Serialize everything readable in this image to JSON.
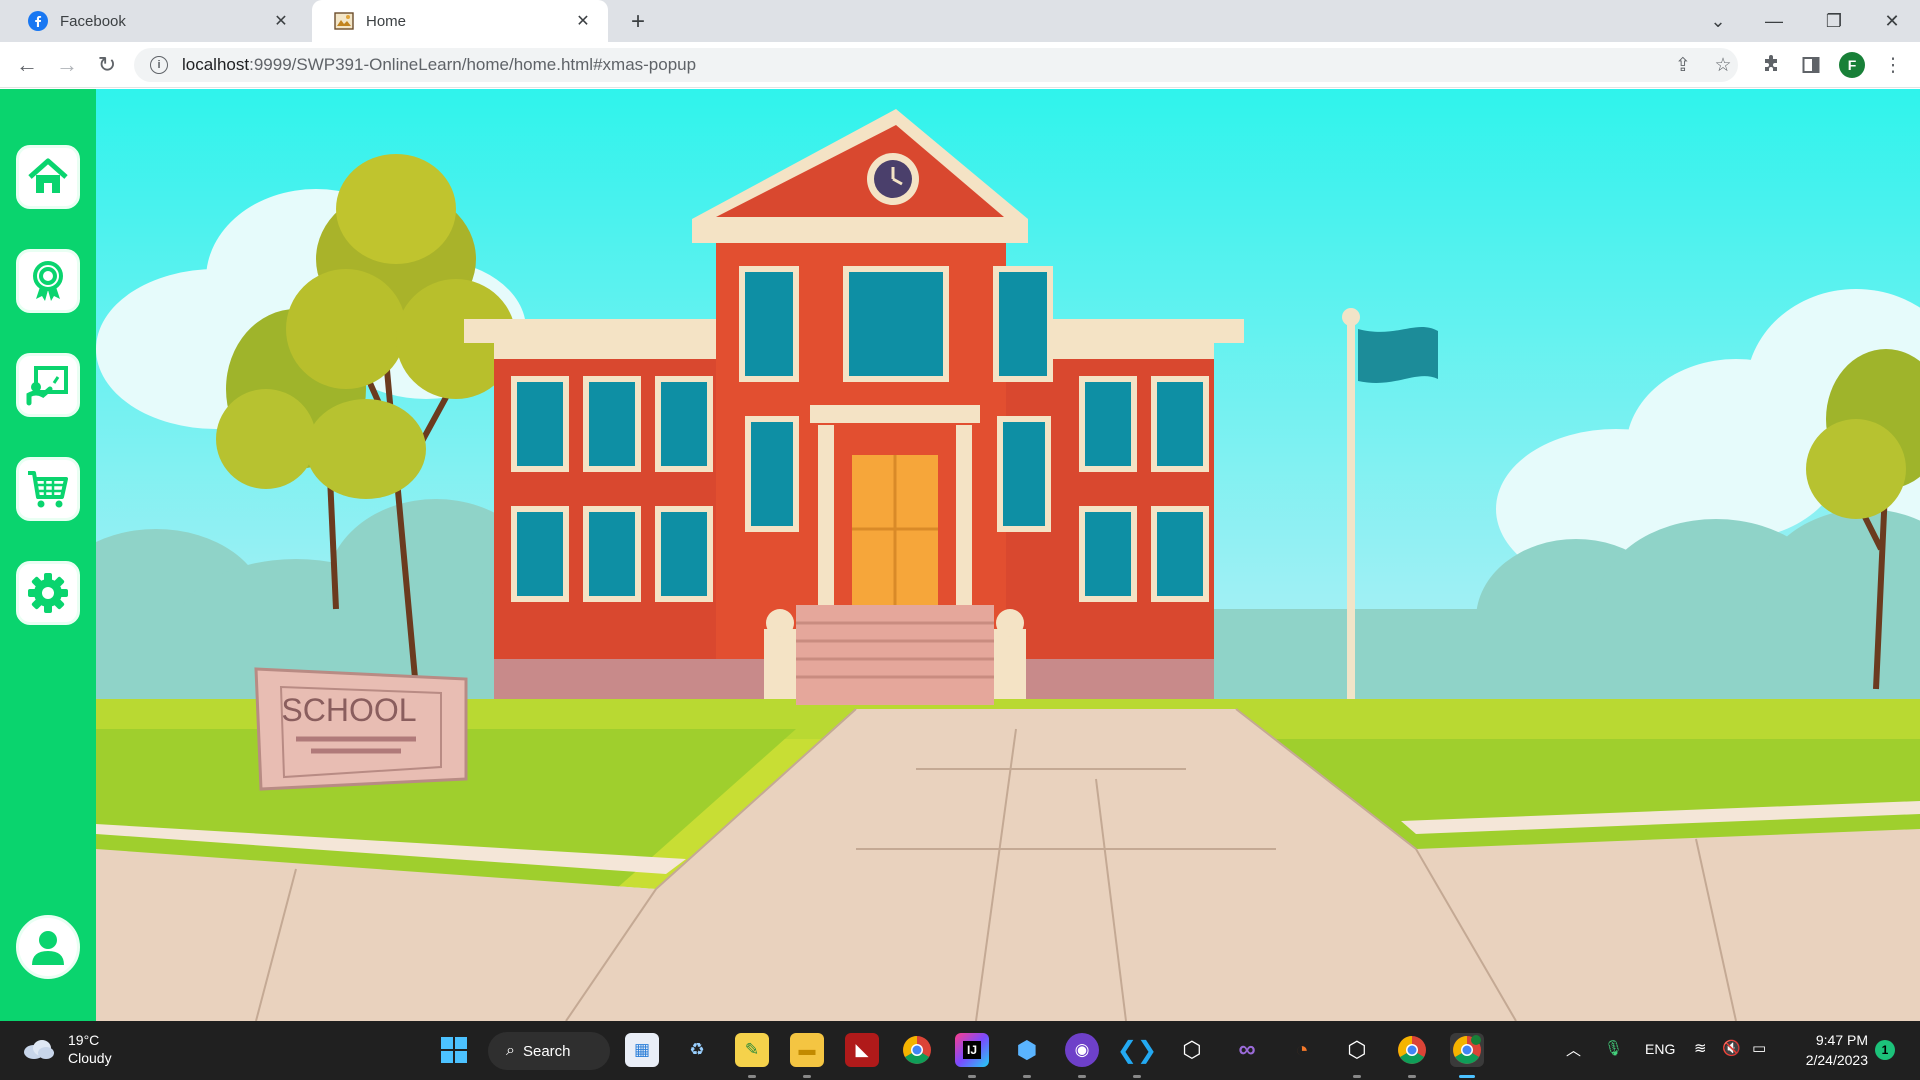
{
  "browser": {
    "tabs": [
      {
        "title": "Facebook",
        "favicon": "facebook-icon",
        "active": false
      },
      {
        "title": "Home",
        "favicon": "page-thumbnail-icon",
        "active": true
      }
    ],
    "new_tab_icon": "plus-icon",
    "url_host": "localhost",
    "url_path": ":9999/SWP391-OnlineLearn/home/home.html#xmas-popup",
    "profile_initial": "F"
  },
  "sidebar": {
    "items": [
      {
        "name": "home",
        "icon": "home-icon"
      },
      {
        "name": "achievements",
        "icon": "award-ribbon-icon"
      },
      {
        "name": "classroom",
        "icon": "teacher-board-icon"
      },
      {
        "name": "shop",
        "icon": "shopping-cart-icon"
      },
      {
        "name": "settings",
        "icon": "gear-icon"
      },
      {
        "name": "profile",
        "icon": "user-icon"
      }
    ],
    "color": "#0ad46e"
  },
  "scene": {
    "sign_text": "SCHOOL"
  },
  "taskbar": {
    "weather": {
      "temp": "19°C",
      "condition": "Cloudy"
    },
    "search_label": "Search",
    "language": "ENG",
    "time": "9:47 PM",
    "date": "2/24/2023",
    "notification_count": "1"
  }
}
